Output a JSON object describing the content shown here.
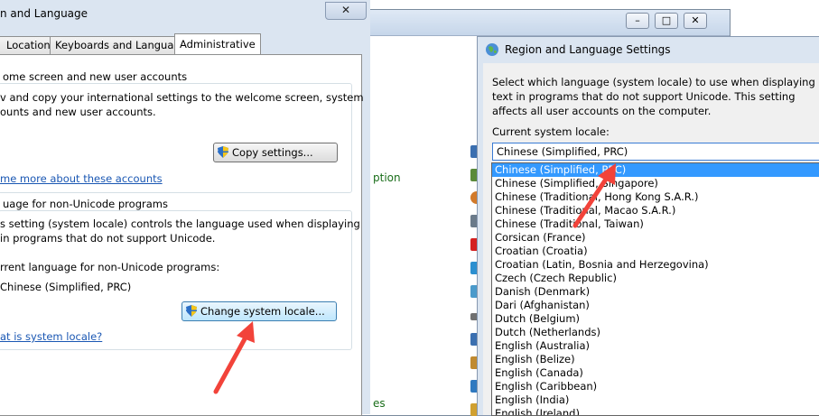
{
  "left_dialog": {
    "title": "n and Language",
    "close_glyph": "✕",
    "tabs": [
      {
        "label": "Location"
      },
      {
        "label": "Keyboards and Languages"
      },
      {
        "label": "Administrative"
      }
    ],
    "welcome_group": {
      "title": "ome screen and new user accounts",
      "line1": "v and copy your international settings to the welcome screen, system",
      "line2": "ounts and new user accounts.",
      "copy_button": "Copy settings...",
      "link": "me more about these accounts"
    },
    "unicode_group": {
      "title": "uage for non-Unicode programs",
      "line1": "s setting (system locale) controls the language used when displaying",
      "line2": "in programs that do not support Unicode.",
      "current_label": "rrent language for non-Unicode programs:",
      "current_value": "Chinese (Simplified, PRC)",
      "change_button": "Change system locale...",
      "link": "at is system locale?"
    }
  },
  "background_window": {
    "minimize_glyph": "–",
    "maximize_glyph": "□",
    "close_glyph": "✕",
    "links": [
      "ption",
      "es"
    ]
  },
  "right_dialog": {
    "title": "Region and Language Settings",
    "prompt": "Select which language (system locale) to use when displaying text in programs that do not support Unicode. This setting affects all user accounts on the computer.",
    "current_label": "Current system locale:",
    "selected_value": "Chinese (Simplified, PRC)",
    "options": [
      "Chinese (Simplified, PRC)",
      "Chinese (Simplified, Singapore)",
      "Chinese (Traditional, Hong Kong S.A.R.)",
      "Chinese (Traditional, Macao S.A.R.)",
      "Chinese (Traditional, Taiwan)",
      "Corsican (France)",
      "Croatian (Croatia)",
      "Croatian (Latin, Bosnia and Herzegovina)",
      "Czech (Czech Republic)",
      "Danish (Denmark)",
      "Dari (Afghanistan)",
      "Dutch (Belgium)",
      "Dutch (Netherlands)",
      "English (Australia)",
      "English (Belize)",
      "English (Canada)",
      "English (Caribbean)",
      "English (India)",
      "English (Ireland)"
    ]
  },
  "colors": {
    "highlight": "#3399ff",
    "annotation_arrow": "#f2433a",
    "link": "#1a57b3"
  }
}
